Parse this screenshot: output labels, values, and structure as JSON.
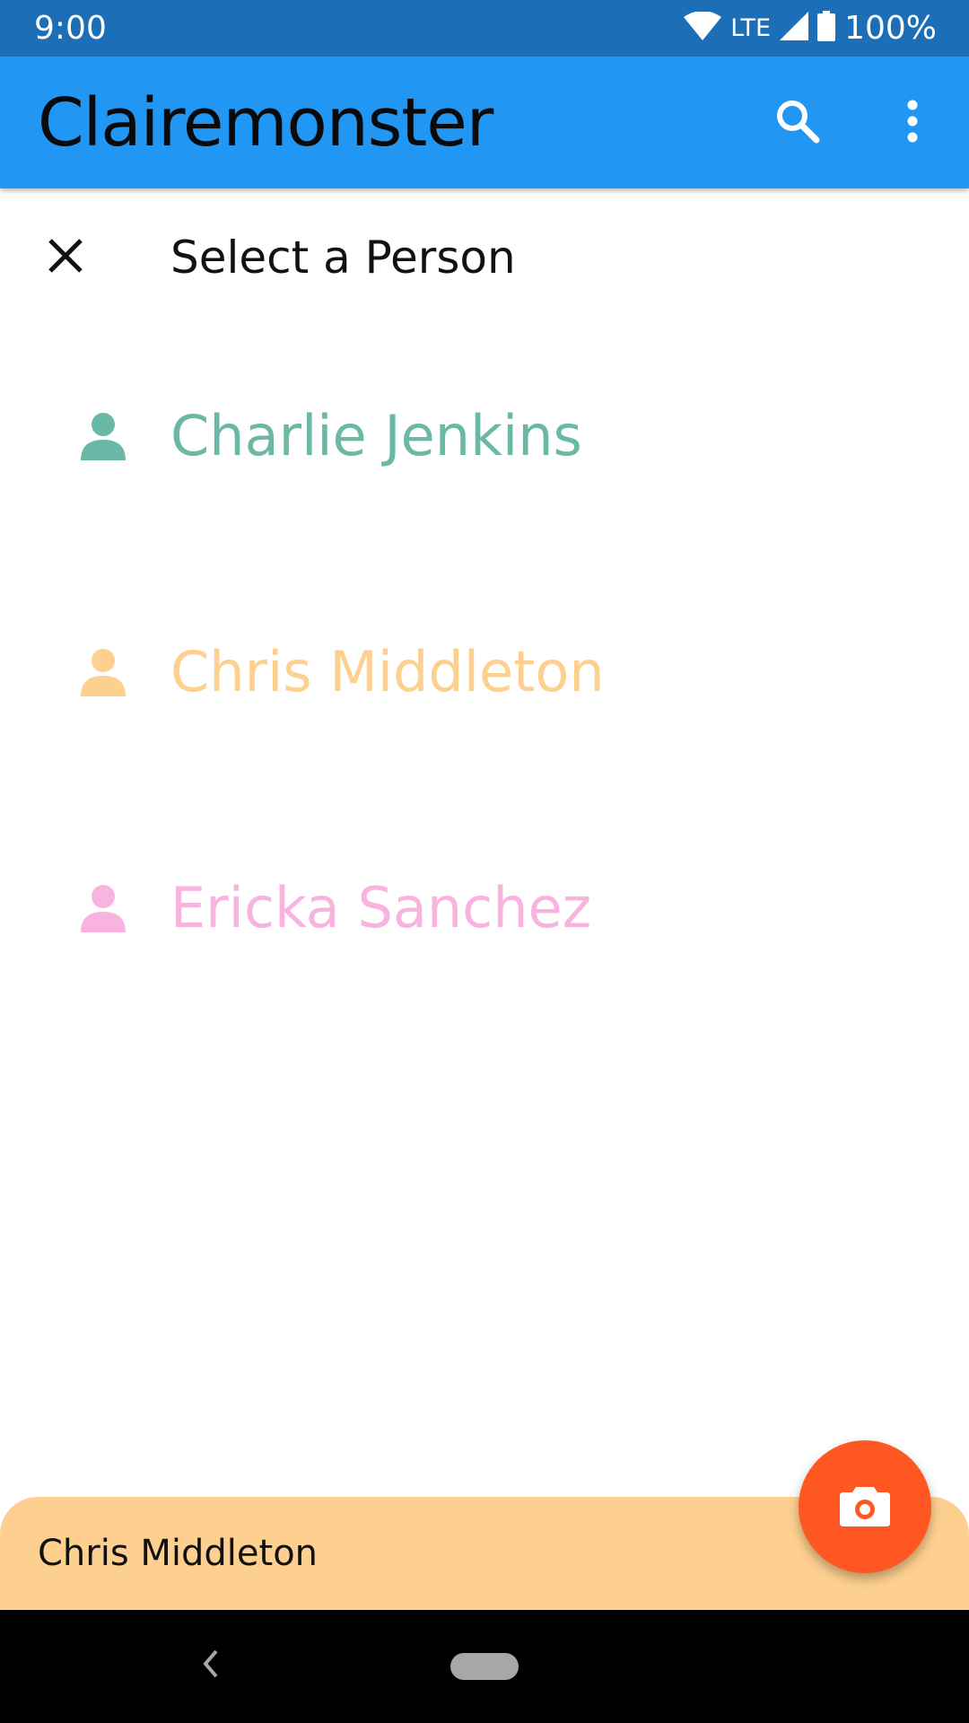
{
  "status_bar": {
    "time": "9:00",
    "network": "LTE",
    "battery": "100%",
    "icons": [
      "wifi-icon",
      "signal-icon",
      "battery-icon"
    ]
  },
  "app_bar": {
    "title": "Clairemonster",
    "actions": [
      "search-icon",
      "more-vert-icon"
    ]
  },
  "dialog": {
    "title": "Select a Person",
    "close_icon": "close-icon"
  },
  "people": [
    {
      "name": "Charlie Jenkins",
      "color": "#6bb8a6",
      "icon": "person-icon"
    },
    {
      "name": "Chris Middleton",
      "color": "#fed08f",
      "icon": "person-icon"
    },
    {
      "name": "Ericka Sanchez",
      "color": "#f8b4df",
      "icon": "person-icon"
    }
  ],
  "bottom_sheet": {
    "selected_name": "Chris Middleton",
    "color": "#fed08f"
  },
  "fab": {
    "icon": "camera-icon",
    "color": "#ff5722"
  },
  "colors": {
    "status_bar": "#1c6fb7",
    "app_bar": "#2196f3"
  }
}
